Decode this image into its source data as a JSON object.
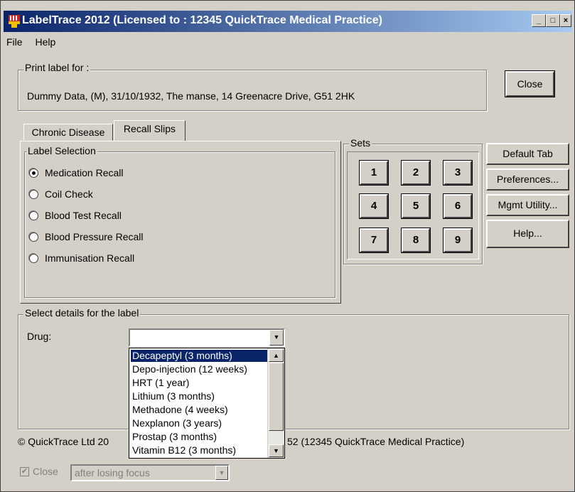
{
  "window": {
    "title": "LabelTrace 2012 (Licensed to : 12345  QuickTrace Medical Practice)",
    "controls": {
      "minimize": "_",
      "maximize": "□",
      "close": "×"
    }
  },
  "menu": {
    "file": "File",
    "help": "Help"
  },
  "print_label": {
    "legend": "Print label for :",
    "patient": "Dummy Data, (M), 31/10/1932, The manse, 14 Greenacre Drive, G51 2HK"
  },
  "buttons": {
    "close": "Close",
    "default_tab": "Default Tab",
    "preferences": "Preferences...",
    "mgmt_utility": "Mgmt Utility...",
    "help": "Help..."
  },
  "tabs": [
    {
      "label": "Chronic Disease",
      "active": false
    },
    {
      "label": "Recall Slips",
      "active": true
    }
  ],
  "label_selection": {
    "legend": "Label Selection",
    "options": [
      {
        "label": "Medication Recall",
        "checked": true
      },
      {
        "label": "Coil Check",
        "checked": false
      },
      {
        "label": "Blood Test Recall",
        "checked": false
      },
      {
        "label": "Blood Pressure Recall",
        "checked": false
      },
      {
        "label": "Immunisation Recall",
        "checked": false
      }
    ]
  },
  "sets": {
    "legend": "Sets",
    "buttons": [
      "1",
      "2",
      "3",
      "4",
      "5",
      "6",
      "7",
      "8",
      "9"
    ]
  },
  "details": {
    "legend": "Select details for the label",
    "drug_label": "Drug:",
    "drug_value": "",
    "drug_options": [
      "Decapeptyl (3 months)",
      "Depo-injection (12 weeks)",
      "HRT (1 year)",
      "Lithium (3 months)",
      "Methadone (4 weeks)",
      "Nexplanon (3 years)",
      "Prostap (3 months)",
      "Vitamin B12 (3 months)"
    ],
    "highlighted_option": "Decapeptyl (3 months)"
  },
  "footer": {
    "copyright_left": "© QuickTrace Ltd 20",
    "copyright_right": "52  (12345  QuickTrace Medical Practice)",
    "close_checkbox_label": "Close",
    "close_checked": true,
    "close_mode_value": "after losing focus"
  },
  "colors": {
    "titlebar_start": "#0a246a",
    "titlebar_end": "#a6caf0",
    "face": "#d4d0c8",
    "selection": "#0a246a"
  },
  "icons": {
    "app": "label-printer-icon",
    "combo": "chevron-down-icon"
  }
}
